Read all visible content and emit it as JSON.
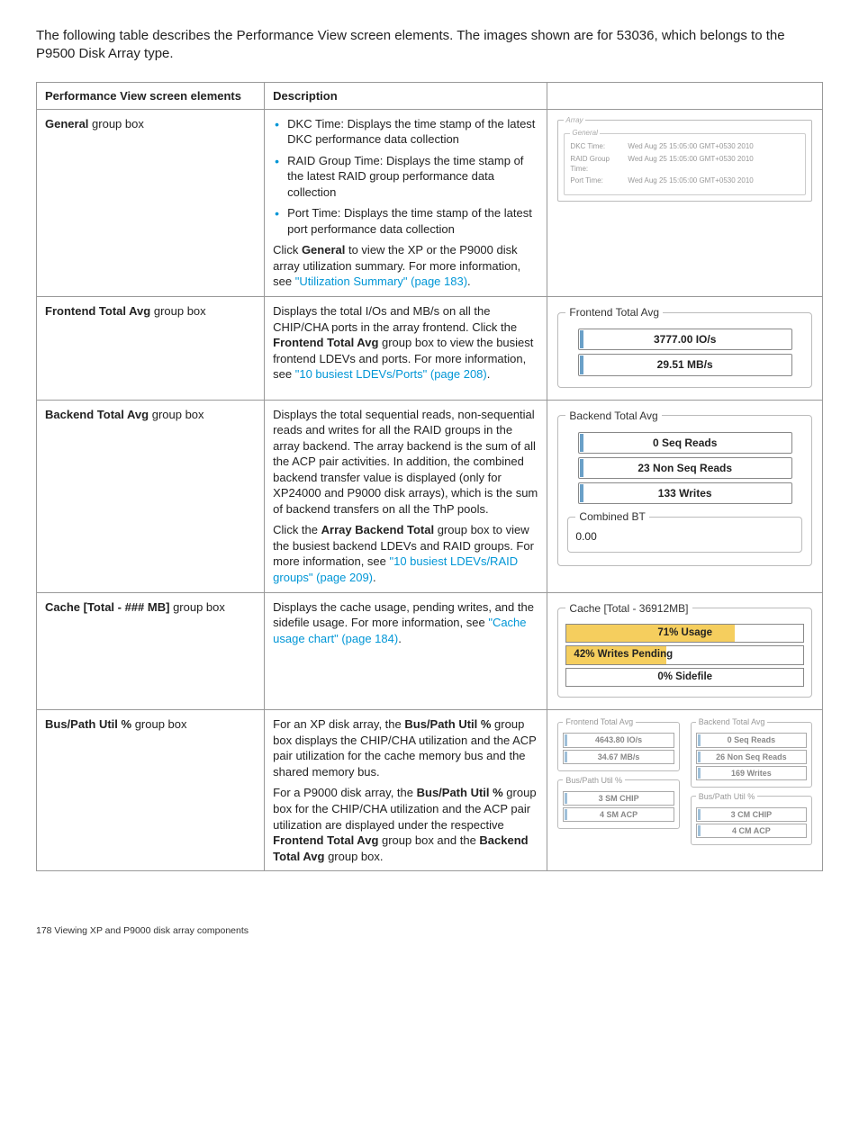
{
  "intro": "The following table describes the Performance View screen elements. The images shown are for 53036, which belongs to the P9500 Disk Array type.",
  "headers": {
    "col1": "Performance View screen elements",
    "col2": "Description"
  },
  "rows": {
    "general": {
      "element_prefix": "General",
      "element_suffix": " group box",
      "bullets": [
        "DKC Time: Displays the time stamp of the latest DKC performance data collection",
        "RAID Group Time: Displays the time stamp of the latest RAID group performance data collection",
        "Port Time: Displays the time stamp of the latest port performance data collection"
      ],
      "after1": "Click ",
      "after_bold": "General",
      "after2": " to view the XP or the P9000 disk array utilization summary. For more information, see ",
      "link": "\"Utilization Summary\" (page 183)",
      "after3": ".",
      "vis": {
        "outer_legend": "Array",
        "inner_legend": "General",
        "rows": [
          {
            "lbl": "DKC Time:",
            "val": "Wed Aug 25 15:05:00 GMT+0530 2010"
          },
          {
            "lbl": "RAID Group Time:",
            "val": "Wed Aug 25 15:05:00 GMT+0530 2010"
          },
          {
            "lbl": "Port Time:",
            "val": "Wed Aug 25 15:05:00 GMT+0530 2010"
          }
        ]
      }
    },
    "frontend": {
      "element_prefix": "Frontend Total Avg",
      "element_suffix": " group box",
      "desc1": "Displays the total I/Os and MB/s on all the CHIP/CHA ports in the array frontend. Click the ",
      "desc_bold": "Frontend Total Avg",
      "desc2": " group box to view the busiest frontend LDEVs and ports. For more information, see ",
      "link": "\"10 busiest LDEVs/Ports\" (page 208)",
      "desc3": ".",
      "vis": {
        "legend": "Frontend Total Avg",
        "stat1": "3777.00 IO/s",
        "stat2": "29.51 MB/s"
      }
    },
    "backend": {
      "element_prefix": "Backend Total Avg",
      "element_suffix": " group box",
      "desc1": "Displays the total sequential reads, non-sequential reads and writes for all the RAID groups in the array backend. The array backend is the sum of all the ACP pair activities. In addition, the combined backend transfer value is displayed (only for XP24000 and P9000 disk arrays), which is the sum of backend transfers on all the ThP pools.",
      "desc2a": "Click the ",
      "desc_bold": "Array Backend Total",
      "desc2b": " group box to view the busiest backend LDEVs and RAID groups. For more information, see ",
      "link": "\"10 busiest LDEVs/RAID groups\" (page 209)",
      "desc3": ".",
      "vis": {
        "legend1": "Backend Total Avg",
        "stat1": "0 Seq Reads",
        "stat2": "23 Non Seq Reads",
        "stat3": "133 Writes",
        "legend2": "Combined BT",
        "val2": "0.00"
      }
    },
    "cache": {
      "element_prefix": "Cache [Total - ### MB]",
      "element_suffix": " group box",
      "desc1": "Displays the cache usage, pending writes, and the sidefile usage. For more information, see ",
      "link": "\"Cache usage chart\" (page 184)",
      "desc2": ".",
      "vis": {
        "legend": "Cache [Total - 36912MB]",
        "row1": {
          "text": "71% Usage",
          "fill": 71
        },
        "row2": {
          "text": "42% Writes Pending",
          "fill": 42
        },
        "row3": {
          "text": "0% Sidefile",
          "fill": 0
        }
      }
    },
    "buspath": {
      "element_prefix": "Bus/Path Util %",
      "element_suffix": " group box",
      "p1a": "For an XP disk array, the ",
      "p1b": "Bus/Path Util %",
      "p1c": " group box displays the CHIP/CHA utilization and the ACP pair utilization for the cache memory bus and the shared memory bus.",
      "p2a": "For a P9000 disk array, the ",
      "p2b": "Bus/Path Util %",
      "p2c": " group box for the CHIP/CHA utilization and the ACP pair utilization are displayed under the respective ",
      "p2d": "Frontend Total Avg",
      "p2e": " group box and the ",
      "p2f": "Backend Total Avg",
      "p2g": " group box.",
      "vis": {
        "left": {
          "fs1": {
            "legend": "Frontend Total Avg",
            "a": "4643.80 IO/s",
            "b": "34.67 MB/s"
          },
          "fs2": {
            "legend": "Bus/Path Util %",
            "a": "3 SM CHIP",
            "b": "4 SM ACP"
          }
        },
        "right": {
          "fs1": {
            "legend": "Backend Total Avg",
            "a": "0 Seq Reads",
            "b": "26 Non Seq Reads",
            "c": "169 Writes"
          },
          "fs2": {
            "legend": "Bus/Path Util %",
            "a": "3 CM CHIP",
            "b": "4 CM ACP"
          }
        }
      }
    }
  },
  "footer": "178   Viewing XP and P9000 disk array components"
}
